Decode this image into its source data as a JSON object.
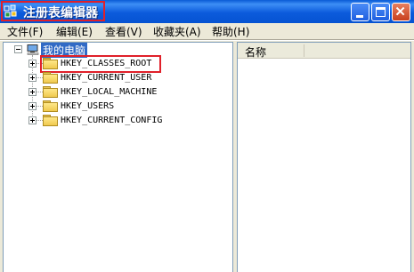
{
  "window": {
    "title": "注册表编辑器"
  },
  "menu": [
    {
      "label": "文件(F)"
    },
    {
      "label": "编辑(E)"
    },
    {
      "label": "查看(V)"
    },
    {
      "label": "收藏夹(A)"
    },
    {
      "label": "帮助(H)"
    }
  ],
  "tree": {
    "root_label": "我的电脑",
    "keys": [
      {
        "label": "HKEY_CLASSES_ROOT"
      },
      {
        "label": "HKEY_CURRENT_USER"
      },
      {
        "label": "HKEY_LOCAL_MACHINE"
      },
      {
        "label": "HKEY_USERS"
      },
      {
        "label": "HKEY_CURRENT_CONFIG"
      }
    ]
  },
  "list": {
    "column_name": "名称"
  },
  "colors": {
    "titlebar": "#0A5BD6",
    "selection": "#316AC5",
    "highlight_box": "#E0202A",
    "chrome": "#ECE9D8"
  }
}
